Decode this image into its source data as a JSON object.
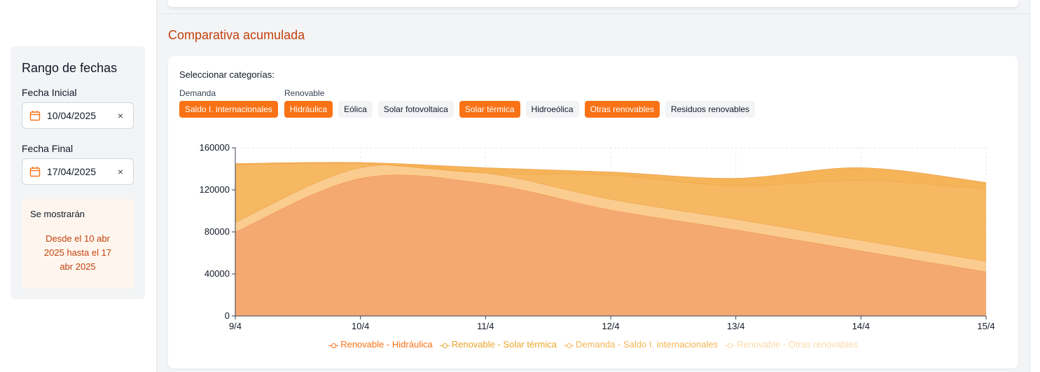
{
  "sidebar": {
    "title": "Rango de fechas",
    "start_label": "Fecha Inicial",
    "start_value": "10/04/2025",
    "end_label": "Fecha Final",
    "end_value": "17/04/2025",
    "clear_glyph": "×",
    "summary_title": "Se mostrarán",
    "summary_text": "Desde el 10 abr 2025 hasta el 17 abr 2025"
  },
  "main": {
    "section_title": "Comparativa acumulada",
    "categories_title": "Seleccionar categorías:",
    "groups": [
      {
        "label": "Demanda"
      },
      {
        "label": "Renovable"
      }
    ],
    "chips": [
      {
        "label": "Saldo I. internacionales",
        "selected": true
      },
      {
        "label": "Hidráulica",
        "selected": true
      },
      {
        "label": "Eólica",
        "selected": false
      },
      {
        "label": "Solar fotovoltaica",
        "selected": false
      },
      {
        "label": "Solar térmica",
        "selected": true
      },
      {
        "label": "Hidroeólica",
        "selected": false
      },
      {
        "label": "Otras renovables",
        "selected": true
      },
      {
        "label": "Residuos renovables",
        "selected": false
      }
    ]
  },
  "colors": {
    "accent": "#f97316",
    "title": "#c2410c"
  },
  "chart_data": {
    "type": "area",
    "stacked": true,
    "x": [
      "9/4",
      "10/4",
      "11/4",
      "12/4",
      "13/4",
      "14/4",
      "15/4"
    ],
    "ylim": [
      0,
      160000
    ],
    "yticks": [
      0,
      40000,
      80000,
      120000,
      160000
    ],
    "grid": true,
    "legend_position": "bottom",
    "series": [
      {
        "name": "Renovable - Hidráulica",
        "color": "#f4a46a",
        "values": [
          80000,
          131000,
          126000,
          101000,
          82000,
          62000,
          42000
        ]
      },
      {
        "name": "Renovable - Otras renovables",
        "color": "#fbc98a",
        "values": [
          9000,
          10000,
          10000,
          10000,
          10000,
          10000,
          10000
        ]
      },
      {
        "name": "Demanda - Saldo I. internacionales",
        "color": "#f6b45a",
        "values": [
          55000,
          4000,
          0,
          23000,
          32000,
          57000,
          69000
        ]
      },
      {
        "name": "Renovable - Solar térmica",
        "color": "#f5b050",
        "values": [
          1000,
          1000,
          5000,
          3000,
          7000,
          12000,
          6000
        ]
      }
    ],
    "legend_order": [
      "Renovable - Hidráulica",
      "Renovable - Solar térmica",
      "Demanda - Saldo I. internacionales",
      "Renovable - Otras renovables"
    ],
    "legend_colors": [
      "#f97316",
      "#eaa52a",
      "#f5b454",
      "#fcd9a8"
    ]
  }
}
